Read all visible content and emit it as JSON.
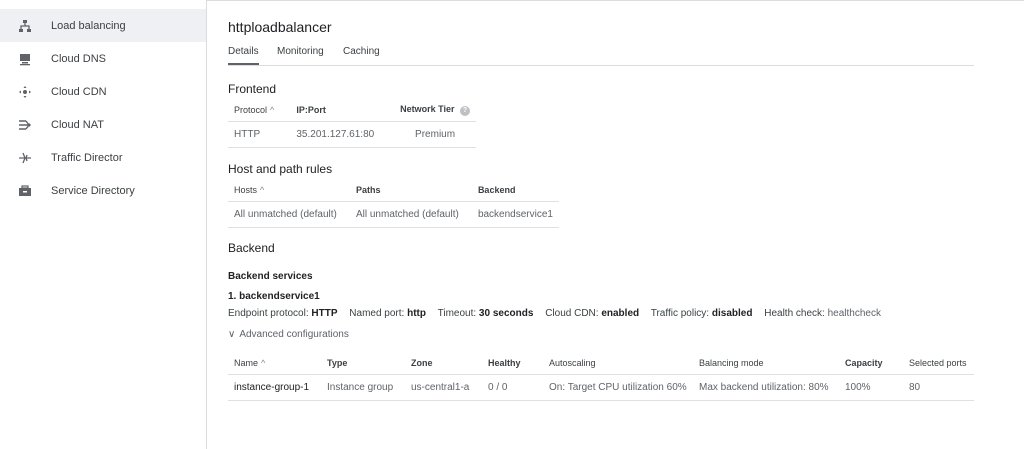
{
  "sidebar": {
    "items": [
      {
        "label": "Load balancing",
        "icon": "load-balancing-icon",
        "active": true
      },
      {
        "label": "Cloud DNS",
        "icon": "cloud-dns-icon"
      },
      {
        "label": "Cloud CDN",
        "icon": "cloud-cdn-icon"
      },
      {
        "label": "Cloud NAT",
        "icon": "cloud-nat-icon"
      },
      {
        "label": "Traffic Director",
        "icon": "traffic-director-icon"
      },
      {
        "label": "Service Directory",
        "icon": "service-directory-icon"
      }
    ]
  },
  "page": {
    "title": "httploadbalancer",
    "tabs": [
      "Details",
      "Monitoring",
      "Caching"
    ]
  },
  "frontend": {
    "heading": "Frontend",
    "headers": {
      "protocol": "Protocol",
      "ipport": "IP:Port",
      "tier": "Network Tier"
    },
    "row": {
      "protocol": "HTTP",
      "ipport": "35.201.127.61:80",
      "tier": "Premium"
    }
  },
  "host_rules": {
    "heading": "Host and path rules",
    "headers": {
      "hosts": "Hosts",
      "paths": "Paths",
      "backend": "Backend"
    },
    "row": {
      "hosts": "All unmatched (default)",
      "paths": "All unmatched (default)",
      "backend": "backendservice1"
    }
  },
  "backend": {
    "heading": "Backend",
    "services_label": "Backend services",
    "service_name": "1. backendservice1",
    "details": {
      "endpoint_label": "Endpoint protocol:",
      "endpoint_value": "HTTP",
      "port_label": "Named port:",
      "port_value": "http",
      "timeout_label": "Timeout:",
      "timeout_value": "30 seconds",
      "cdn_label": "Cloud CDN:",
      "cdn_value": "enabled",
      "policy_label": "Traffic policy:",
      "policy_value": "disabled",
      "health_label": "Health check:",
      "health_value": "healthcheck"
    },
    "advanced_label": "Advanced configurations",
    "table": {
      "headers": {
        "name": "Name",
        "type": "Type",
        "zone": "Zone",
        "healthy": "Healthy",
        "autoscaling": "Autoscaling",
        "balancing": "Balancing mode",
        "capacity": "Capacity",
        "ports": "Selected ports"
      },
      "row": {
        "name": "instance-group-1",
        "type": "Instance group",
        "zone": "us-central1-a",
        "healthy": "0 / 0",
        "autoscaling": "On: Target CPU utilization 60%",
        "balancing": "Max backend utilization: 80%",
        "capacity": "100%",
        "ports": "80"
      }
    }
  },
  "glyphs": {
    "sort_up": "^",
    "help": "?",
    "chevron": "∨"
  }
}
